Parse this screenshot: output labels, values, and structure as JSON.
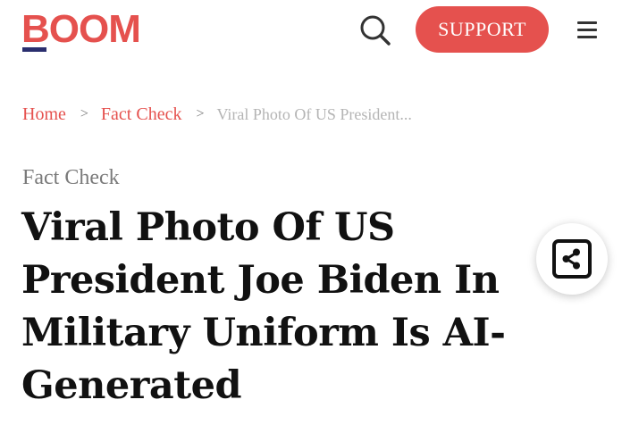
{
  "header": {
    "logo_text": "BOOM",
    "support_label": "SUPPORT",
    "search_icon": "search-icon",
    "menu_icon": "hamburger-menu-icon",
    "brand_color": "#e5514e"
  },
  "breadcrumb": {
    "home": "Home",
    "separator": ">",
    "section": "Fact Check",
    "current": "Viral Photo Of US President..."
  },
  "article": {
    "category": "Fact Check",
    "title": "Viral Photo Of US President Joe Biden In Military Uniform Is AI-Generated"
  },
  "share": {
    "icon": "share-icon"
  }
}
